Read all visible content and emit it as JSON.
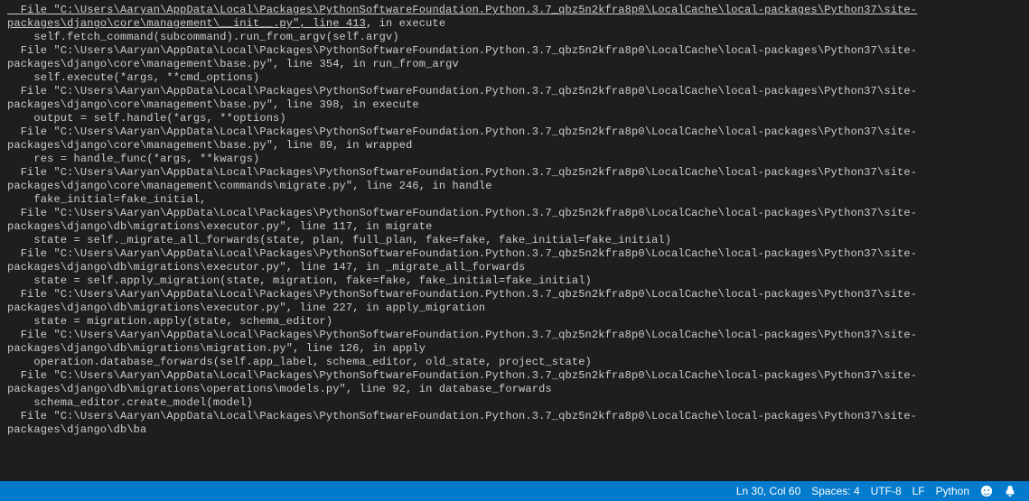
{
  "terminal": {
    "lines": [
      {
        "type": "file-underline",
        "text": "  File \"C:\\Users\\Aaryan\\AppData\\Local\\Packages\\PythonSoftwareFoundation.Python.3.7_qbz5n2kfra8p0\\LocalCache\\local-packages\\Python37\\site-packages\\django\\core\\management\\__init__.py\", line 413",
        "suffix": ", in execute"
      },
      {
        "type": "code",
        "text": "    self.fetch_command(subcommand).run_from_argv(self.argv)"
      },
      {
        "type": "file",
        "text": "  File \"C:\\Users\\Aaryan\\AppData\\Local\\Packages\\PythonSoftwareFoundation.Python.3.7_qbz5n2kfra8p0\\LocalCache\\local-packages\\Python37\\site-packages\\django\\core\\management\\base.py\", line 354, in run_from_argv"
      },
      {
        "type": "code",
        "text": "    self.execute(*args, **cmd_options)"
      },
      {
        "type": "file",
        "text": "  File \"C:\\Users\\Aaryan\\AppData\\Local\\Packages\\PythonSoftwareFoundation.Python.3.7_qbz5n2kfra8p0\\LocalCache\\local-packages\\Python37\\site-packages\\django\\core\\management\\base.py\", line 398, in execute"
      },
      {
        "type": "code",
        "text": "    output = self.handle(*args, **options)"
      },
      {
        "type": "file",
        "text": "  File \"C:\\Users\\Aaryan\\AppData\\Local\\Packages\\PythonSoftwareFoundation.Python.3.7_qbz5n2kfra8p0\\LocalCache\\local-packages\\Python37\\site-packages\\django\\core\\management\\base.py\", line 89, in wrapped"
      },
      {
        "type": "code",
        "text": "    res = handle_func(*args, **kwargs)"
      },
      {
        "type": "file",
        "text": "  File \"C:\\Users\\Aaryan\\AppData\\Local\\Packages\\PythonSoftwareFoundation.Python.3.7_qbz5n2kfra8p0\\LocalCache\\local-packages\\Python37\\site-packages\\django\\core\\management\\commands\\migrate.py\", line 246, in handle"
      },
      {
        "type": "code",
        "text": "    fake_initial=fake_initial,"
      },
      {
        "type": "file",
        "text": "  File \"C:\\Users\\Aaryan\\AppData\\Local\\Packages\\PythonSoftwareFoundation.Python.3.7_qbz5n2kfra8p0\\LocalCache\\local-packages\\Python37\\site-packages\\django\\db\\migrations\\executor.py\", line 117, in migrate"
      },
      {
        "type": "code",
        "text": "    state = self._migrate_all_forwards(state, plan, full_plan, fake=fake, fake_initial=fake_initial)"
      },
      {
        "type": "file",
        "text": "  File \"C:\\Users\\Aaryan\\AppData\\Local\\Packages\\PythonSoftwareFoundation.Python.3.7_qbz5n2kfra8p0\\LocalCache\\local-packages\\Python37\\site-packages\\django\\db\\migrations\\executor.py\", line 147, in _migrate_all_forwards"
      },
      {
        "type": "code",
        "text": "    state = self.apply_migration(state, migration, fake=fake, fake_initial=fake_initial)"
      },
      {
        "type": "file",
        "text": "  File \"C:\\Users\\Aaryan\\AppData\\Local\\Packages\\PythonSoftwareFoundation.Python.3.7_qbz5n2kfra8p0\\LocalCache\\local-packages\\Python37\\site-packages\\django\\db\\migrations\\executor.py\", line 227, in apply_migration"
      },
      {
        "type": "code",
        "text": "    state = migration.apply(state, schema_editor)"
      },
      {
        "type": "file",
        "text": "  File \"C:\\Users\\Aaryan\\AppData\\Local\\Packages\\PythonSoftwareFoundation.Python.3.7_qbz5n2kfra8p0\\LocalCache\\local-packages\\Python37\\site-packages\\django\\db\\migrations\\migration.py\", line 126, in apply"
      },
      {
        "type": "code",
        "text": "    operation.database_forwards(self.app_label, schema_editor, old_state, project_state)"
      },
      {
        "type": "file",
        "text": "  File \"C:\\Users\\Aaryan\\AppData\\Local\\Packages\\PythonSoftwareFoundation.Python.3.7_qbz5n2kfra8p0\\LocalCache\\local-packages\\Python37\\site-packages\\django\\db\\migrations\\operations\\models.py\", line 92, in database_forwards"
      },
      {
        "type": "code",
        "text": "    schema_editor.create_model(model)"
      },
      {
        "type": "file",
        "text": "  File \"C:\\Users\\Aaryan\\AppData\\Local\\Packages\\PythonSoftwareFoundation.Python.3.7_qbz5n2kfra8p0\\LocalCache\\local-packages\\Python37\\site-packages\\django\\db\\ba"
      }
    ]
  },
  "statusbar": {
    "cursor": "Ln 30, Col 60",
    "spaces": "Spaces: 4",
    "encoding": "UTF-8",
    "eol": "LF",
    "language": "Python"
  }
}
